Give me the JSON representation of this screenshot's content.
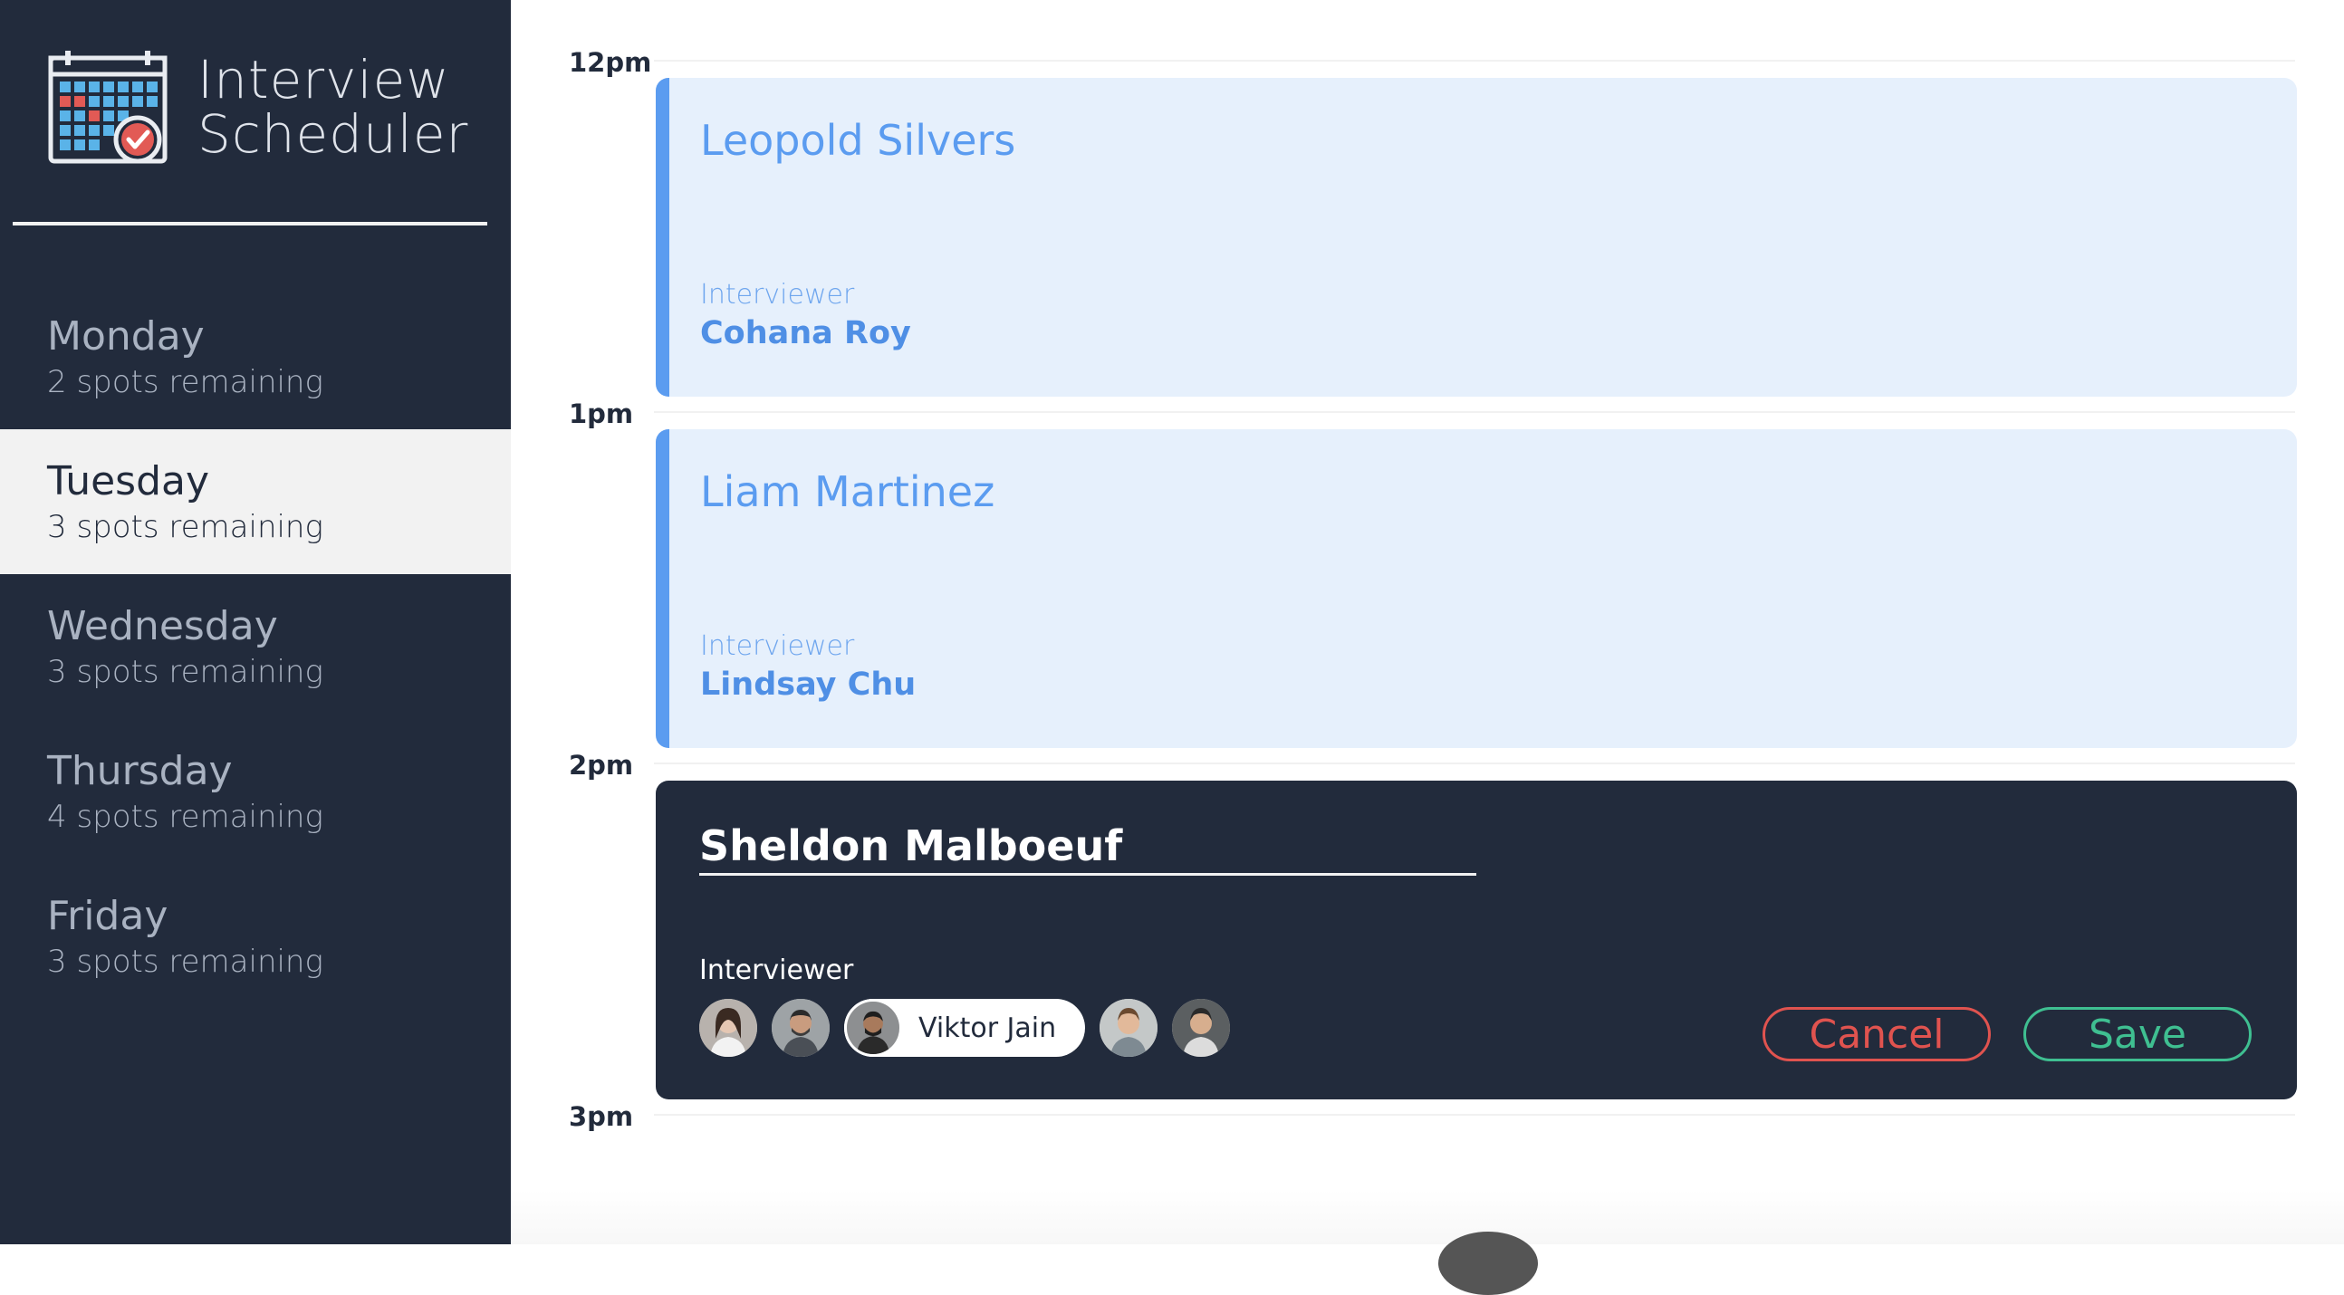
{
  "brand": {
    "line1": "Interview",
    "line2": "Scheduler",
    "logo_icon": "calendar-check-icon"
  },
  "sidebar": {
    "days": [
      {
        "name": "Monday",
        "spots": "2 spots remaining",
        "selected": false
      },
      {
        "name": "Tuesday",
        "spots": "3 spots remaining",
        "selected": true
      },
      {
        "name": "Wednesday",
        "spots": "3 spots remaining",
        "selected": false
      },
      {
        "name": "Thursday",
        "spots": "4 spots remaining",
        "selected": false
      },
      {
        "name": "Friday",
        "spots": "3 spots remaining",
        "selected": false
      }
    ]
  },
  "schedule": {
    "hours": [
      "12pm",
      "1pm",
      "2pm",
      "3pm"
    ],
    "appointments": [
      {
        "student": "Leopold Silvers",
        "interviewer_label": "Interviewer",
        "interviewer": "Cohana Roy"
      },
      {
        "student": "Liam Martinez",
        "interviewer_label": "Interviewer",
        "interviewer": "Lindsay Chu"
      }
    ],
    "form": {
      "student_value": "Sheldon Malboeuf",
      "interviewer_label": "Interviewer",
      "selected_interviewer": "Viktor Jain",
      "cancel_label": "Cancel",
      "save_label": "Save"
    }
  },
  "colors": {
    "sidebar": "#222b3c",
    "appointment_bg": "#e6f0fc",
    "appointment_accent": "#5b9cf0",
    "cancel": "#e0534f",
    "save": "#3fbf91"
  }
}
